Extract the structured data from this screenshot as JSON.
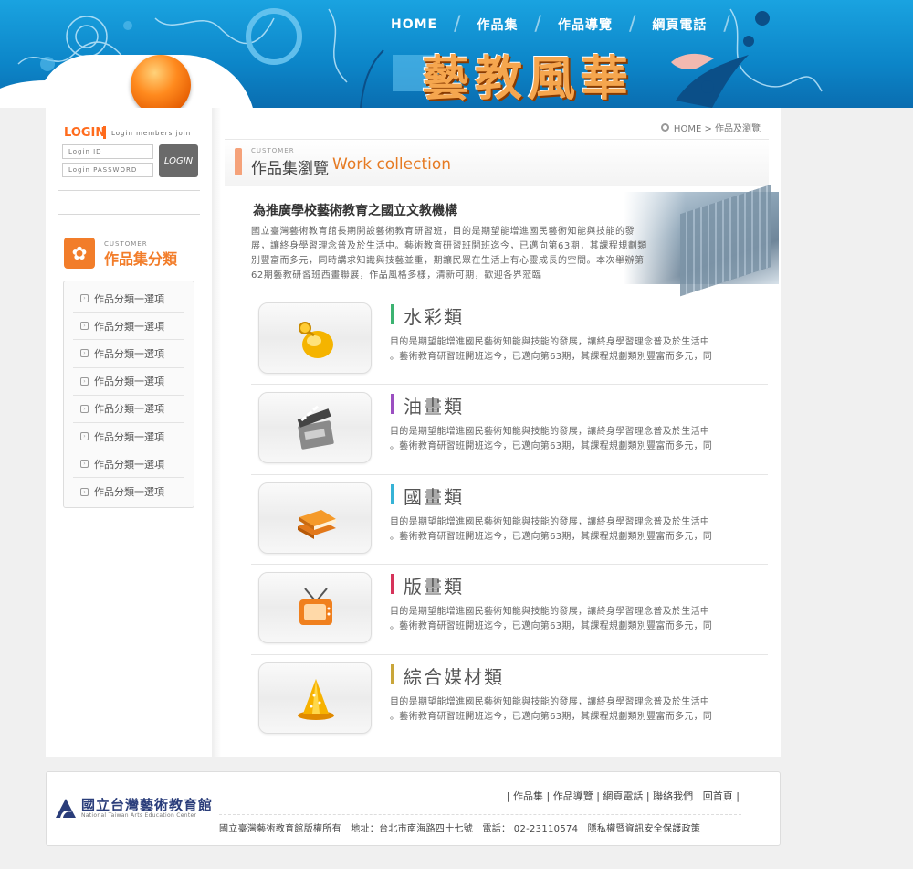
{
  "header": {
    "nav": [
      "HOME",
      "作品集",
      "作品導覽",
      "網頁電話"
    ],
    "site_title": "藝教風華"
  },
  "login": {
    "title": "LOGIN",
    "subtitle": "Login members join",
    "id_placeholder": "Login ID",
    "password_placeholder": "Login PASSWORD",
    "button_label": "LOGIN"
  },
  "categories": {
    "subtitle": "CUSTOMER",
    "title": "作品集分類",
    "items": [
      {
        "label": "作品分類一選項"
      },
      {
        "label": "作品分類一選項"
      },
      {
        "label": "作品分類一選項"
      },
      {
        "label": "作品分類一選項"
      },
      {
        "label": "作品分類一選項"
      },
      {
        "label": "作品分類一選項"
      },
      {
        "label": "作品分類一選項"
      },
      {
        "label": "作品分類一選項"
      }
    ]
  },
  "breadcrumb": "HOME > 作品及瀏覽",
  "page_head": {
    "subtitle": "CUSTOMER",
    "title_zh": "作品集瀏覽",
    "title_en": "Work collection"
  },
  "intro": {
    "title": "為推廣學校藝術教育之國立文教機構",
    "body": "國立臺灣藝術教育館長期開設藝術教育研習班，目的是期望能增進國民藝術知能與技能的發展，讓終身學習理念普及於生活中。藝術教育研習班開班迄今，已邁向第63期，其課程規劃類別豐富而多元，同時講求知識與技藝並重，期讓民眾在生活上有心靈成長的空間。本次舉辦第62期藝教研習班西畫聯展，作品風格多樣，清新可期，歡迎各界蒞臨"
  },
  "works": [
    {
      "name": "水彩類",
      "color": "#3cb371",
      "icon": "bell-icon",
      "line1": "目的是期望能增進國民藝術知能與技能的發展，讓終身學習理念普及於生活中",
      "line2": "。藝術教育研習班開班迄今，已邁向第63期，其課程規劃類別豐富而多元，同"
    },
    {
      "name": "油畫類",
      "color": "#9b4fc1",
      "icon": "clapperboard-icon",
      "line1": "目的是期望能增進國民藝術知能與技能的發展，讓終身學習理念普及於生活中",
      "line2": "。藝術教育研習班開班迄今，已邁向第63期，其課程規劃類別豐富而多元，同"
    },
    {
      "name": "國畫類",
      "color": "#36b3d6",
      "icon": "books-icon",
      "line1": "目的是期望能增進國民藝術知能與技能的發展，讓終身學習理念普及於生活中",
      "line2": "。藝術教育研習班開班迄今，已邁向第63期，其課程規劃類別豐富而多元，同"
    },
    {
      "name": "版畫類",
      "color": "#d6335a",
      "icon": "tv-icon",
      "line1": "目的是期望能增進國民藝術知能與技能的發展，讓終身學習理念普及於生活中",
      "line2": "。藝術教育研習班開班迄今，已邁向第63期，其課程規劃類別豐富而多元，同"
    },
    {
      "name": "綜合媒材類",
      "color": "#c9a63a",
      "icon": "cone-icon",
      "line1": "目的是期望能增進國民藝術知能與技能的發展，讓終身學習理念普及於生活中",
      "line2": "。藝術教育研習班開班迄今，已邁向第63期，其課程規劃類別豐富而多元，同"
    }
  ],
  "footer": {
    "logo_zh": "國立台灣藝術教育館",
    "logo_en": "National Taiwan Arts Education Center",
    "links": "| 作品集 | 作品導覽 | 網頁電話 | 聯絡我們 | 回首頁 |",
    "copyright": "國立臺灣藝術教育館版權所有　地址：台北市南海路四十七號　電話： 02-23110574　隱私權暨資訊安全保護政策"
  }
}
